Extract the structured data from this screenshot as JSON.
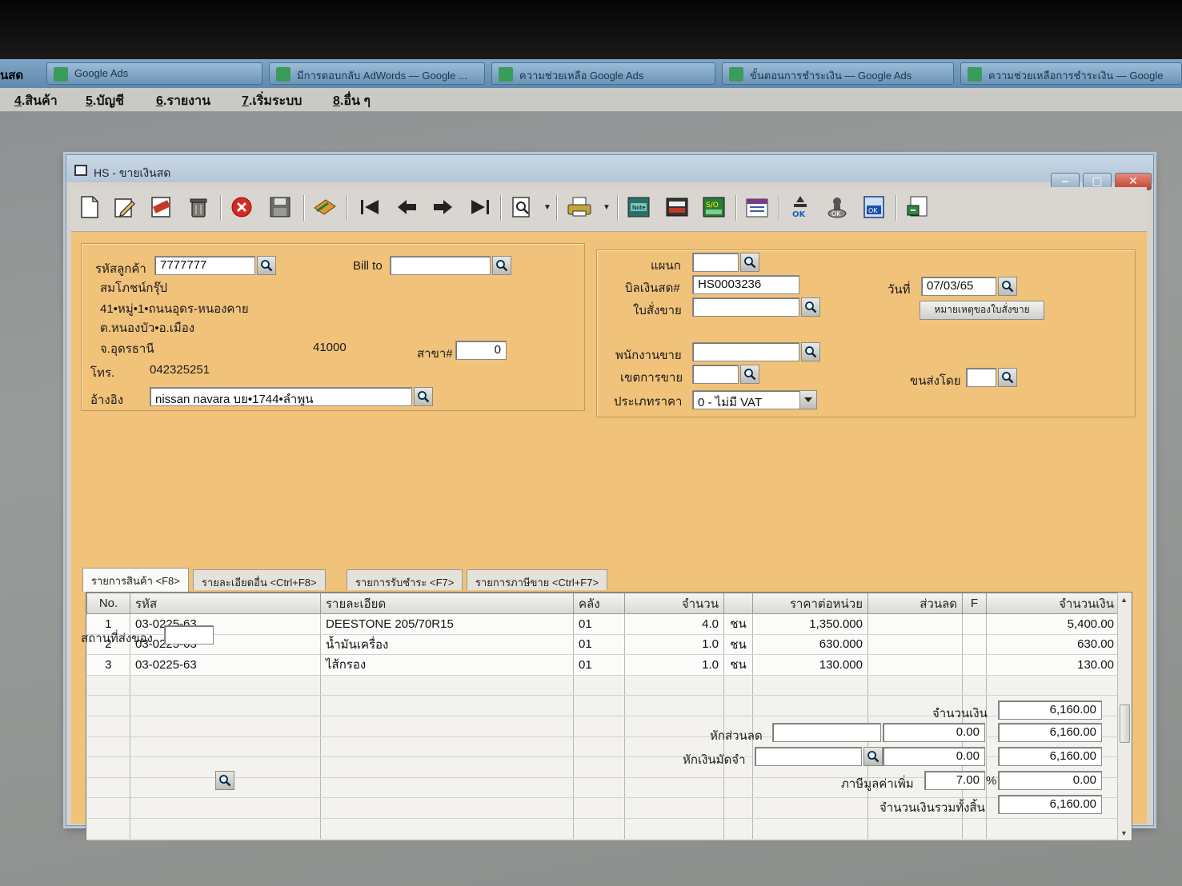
{
  "taskbar": {
    "left_label": "นสด",
    "tabs": [
      "Google Ads",
      "มีการตอบกลับ AdWords — Google ...",
      "ความช่วยเหลือ Google Ads",
      "ขั้นตอนการชำระเงิน — Google Ads",
      "ความช่วยเหลือการชำระเงิน — Google"
    ]
  },
  "menu": [
    {
      "key": "4",
      "label": ".สินค้า"
    },
    {
      "key": "5",
      "label": ".บัญชี"
    },
    {
      "key": "6",
      "label": ".รายงาน"
    },
    {
      "key": "7",
      "label": ".เริ่มระบบ"
    },
    {
      "key": "8",
      "label": ".อื่น ๆ"
    }
  ],
  "window": {
    "title": "HS - ขายเงินสด",
    "controls": {
      "minimize": "‒",
      "maximize": "▢",
      "close": "✕"
    }
  },
  "toolbar_icons": [
    "new-document-icon",
    "edit-icon",
    "void-icon",
    "trash-icon",
    "cancel-icon",
    "save-icon",
    "attachment-icon",
    "first-record-icon",
    "previous-record-icon",
    "next-record-icon",
    "last-record-icon",
    "search-document-icon",
    "print-icon",
    "note-icon",
    "screen-icon",
    "sales-order-icon",
    "calendar-icon",
    "approve-icon",
    "stamp-icon",
    "ok-document-icon",
    "export-icon"
  ],
  "customer": {
    "code_label": "รหัสลูกค้า",
    "code": "7777777",
    "bill_to_label": "Bill to",
    "bill_to": "",
    "name": "สมโภชน์กรุ๊ป",
    "address1": "41•หมู่•1•ถนนอุดร-หนองคาย",
    "address2": "ต.หนองบัว•อ.เมือง",
    "province": "จ.อุดรธานี",
    "postcode": "41000",
    "branch_label": "สาขา#",
    "branch": "0",
    "phone_label": "โทร.",
    "phone": "042325251",
    "reference_label": "อ้างอิง",
    "reference": "nissan navara บย•1744•ลำพูน"
  },
  "document": {
    "department_label": "แผนก",
    "department": "",
    "bill_label": "บิลเงินสด#",
    "bill_no": "HS0003236",
    "date_label": "วันที่",
    "date": "07/03/65",
    "order_label": "ใบสั่งขาย",
    "order": "",
    "order_note_button": "หมายเหตุของใบสั่งขาย",
    "salesman_label": "พนักงานขาย",
    "salesman": "",
    "area_label": "เขตการขาย",
    "area": "",
    "ship_by_label": "ขนส่งโดย",
    "ship_by": "",
    "price_type_label": "ประเภทราคา",
    "price_type": "0 - ไม่มี VAT"
  },
  "tabs": [
    "รายการสินค้า <F8>",
    "รายละเอียดอื่น <Ctrl+F8>",
    "รายการรับชำระ <F7>",
    "รายการภาษีขาย <Ctrl+F7>"
  ],
  "grid": {
    "headers": [
      "No.",
      "รหัส",
      "รายละเอียด",
      "คลัง",
      "จำนวน",
      "",
      "ราคาต่อหน่วย",
      "ส่วนลด",
      "F",
      "จำนวนเงิน"
    ],
    "rows": [
      {
        "no": "1",
        "code": "03-0225-63",
        "desc": "DEESTONE 205/70R15",
        "wh": "01",
        "qty": "4.0",
        "unit": "ชน",
        "price": "1,350.000",
        "disc": "",
        "f": "",
        "amount": "5,400.00"
      },
      {
        "no": "2",
        "code": "03-0225-63",
        "desc": "น้ำมันเครื่อง",
        "wh": "01",
        "qty": "1.0",
        "unit": "ชน",
        "price": "630.000",
        "disc": "",
        "f": "",
        "amount": "630.00"
      },
      {
        "no": "3",
        "code": "03-0225-63",
        "desc": "ไส้กรอง",
        "wh": "01",
        "qty": "1.0",
        "unit": "ชน",
        "price": "130.000",
        "disc": "",
        "f": "",
        "amount": "130.00"
      }
    ],
    "empty_rows": 8
  },
  "footer": {
    "ship_place_label": "สถานที่ส่งของ",
    "ship_place": "",
    "amount_label": "จำนวนเงิน",
    "amount": "6,160.00",
    "discount_label": "หักส่วนลด",
    "discount_text": "",
    "discount_value": "0.00",
    "after_discount": "6,160.00",
    "deposit_label": "หักเงินมัดจำ",
    "deposit_text": "",
    "deposit_value": "0.00",
    "after_deposit": "6,160.00",
    "vat_label": "ภาษีมูลค่าเพิ่ม",
    "vat_rate": "7.00",
    "vat_percent": "%",
    "vat_amount": "0.00",
    "total_label": "จำนวนเงินรวมทั้งสิ้น",
    "total": "6,160.00"
  }
}
